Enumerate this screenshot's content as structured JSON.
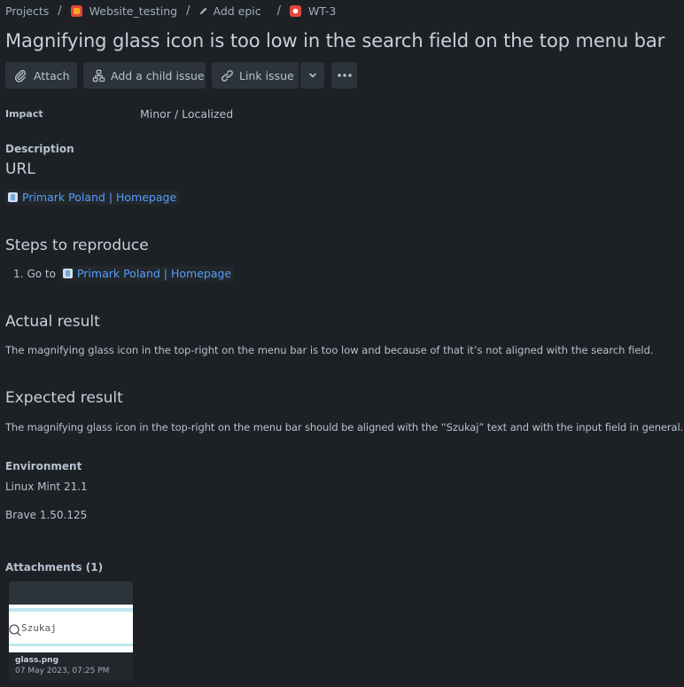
{
  "breadcrumb": {
    "projects": "Projects",
    "project": "Website_testing",
    "epic": "Add epic",
    "issue_key": "WT-3",
    "sep": "/"
  },
  "issue": {
    "title": "Magnifying glass icon is too low in the search field on the top menu bar"
  },
  "toolbar": {
    "attach": "Attach",
    "add_child": "Add a child issue",
    "link_issue": "Link issue"
  },
  "fields": {
    "impact_label": "Impact",
    "impact_value": "Minor / Localized"
  },
  "description": {
    "label": "Description",
    "url_heading": "URL",
    "url_link": "Primark Poland | Homepage",
    "steps_heading": "Steps to reproduce",
    "step1_number": "1.",
    "step1_prefix": "Go to",
    "step1_link": "Primark Poland | Homepage",
    "actual_heading": "Actual result",
    "actual_text": "The magnifying glass icon in the top-right on the menu bar is too low and because of that it’s not aligned with the search field.",
    "expected_heading": "Expected result",
    "expected_text": "The magnifying glass icon in the top-right on the menu bar should be aligned with the “Szukaj” text and with the input field in general.",
    "environment_label": "Environment",
    "env_os": "Linux Mint 21.1",
    "env_browser": "Brave 1.50.125"
  },
  "attachments": {
    "label": "Attachments (1)",
    "items": [
      {
        "thumb_text": "Szukaj",
        "filename": "glass.png",
        "date": "07 May 2023, 07:25 PM"
      }
    ]
  },
  "colors": {
    "background": "#1d2125",
    "text": "#b6c2cf",
    "link": "#579dff",
    "button_bg": "#2c333a"
  }
}
